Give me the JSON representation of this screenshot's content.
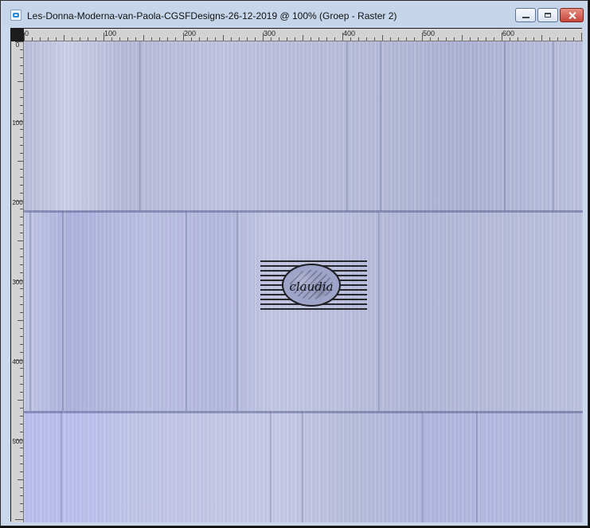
{
  "window": {
    "title": "Les-Donna-Moderna-van-Paola-CGSFDesigns-26-12-2019 @ 100% (Groep - Raster 2)",
    "icon": "app-icon",
    "controls": {
      "minimize": "minimize-icon",
      "maximize": "maximize-icon",
      "close": "close-icon"
    }
  },
  "rulers": {
    "top_labels": [
      "0",
      "100",
      "200",
      "300",
      "400",
      "500",
      "600"
    ],
    "left_labels": [
      "0",
      "100",
      "200",
      "300",
      "400",
      "500"
    ]
  },
  "canvas": {
    "logo_text": "claudia"
  }
}
